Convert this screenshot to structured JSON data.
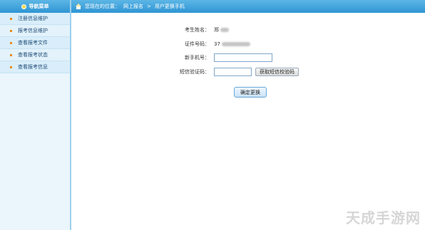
{
  "sidebar": {
    "title": "导航菜单",
    "items": [
      {
        "label": "注册信息维护"
      },
      {
        "label": "报考信息维护"
      },
      {
        "label": "查看报考文件"
      },
      {
        "label": "查看报考状态"
      },
      {
        "label": "查看报考信息"
      }
    ]
  },
  "topbar": {
    "location_prefix": "您现在的位置：",
    "crumb_1": "网上报名",
    "separator": ">",
    "crumb_2": "用户更换手机"
  },
  "form": {
    "name_label": "考生姓名：",
    "name_value": "郑",
    "id_label": "证件号码：",
    "id_value": "37",
    "phone_label": "新手机号：",
    "phone_value": "",
    "sms_label": "短信验证码：",
    "sms_value": "",
    "get_code_button": "获取短信校验码",
    "submit_button": "确定更换"
  },
  "watermark": "天成手游网"
}
